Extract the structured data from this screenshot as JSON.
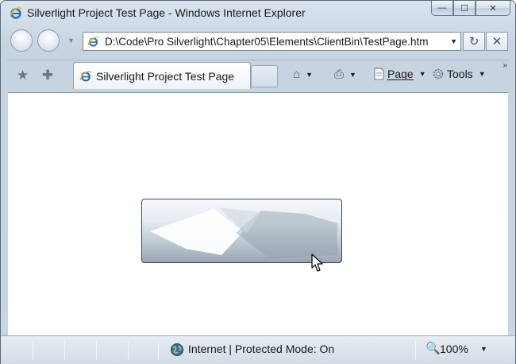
{
  "window": {
    "title": "Silverlight Project Test Page - Windows Internet Explorer",
    "caption_buttons": {
      "minimize": "—",
      "maximize": "☐",
      "close": "✕"
    }
  },
  "navigation": {
    "address_value": "D:\\Code\\Pro Silverlight\\Chapter05\\Elements\\ClientBin\\TestPage.htm",
    "dropdown_glyph": "▼",
    "refresh_glyph": "↻",
    "stop_glyph": "✕"
  },
  "command_bar": {
    "favorites_glyph": "★",
    "add_favorites_glyph": "✚",
    "tab_label": "Silverlight Project Test Page",
    "home_glyph": "⌂",
    "print_glyph": "⎙",
    "page_label": "Page",
    "tools_label": "Tools",
    "arrow_glyph": "▼",
    "more_glyph": "»"
  },
  "content": {
    "button_label": ""
  },
  "status": {
    "zone_text": "Internet | Protected Mode: On",
    "zoom_text": "100%",
    "zoom_glyph": "🔍",
    "arrow_glyph": "▼"
  },
  "colors": {
    "frame": "#c9d6e3",
    "accent": "#2f6db3"
  }
}
